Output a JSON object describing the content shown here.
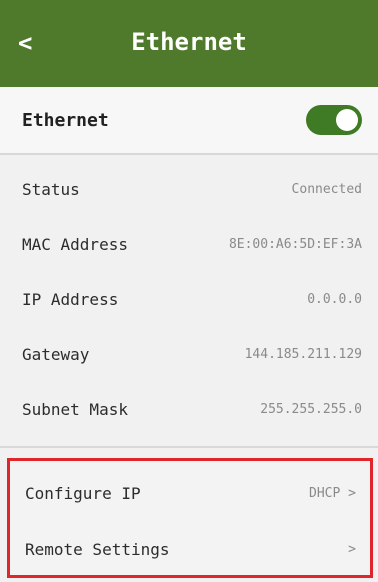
{
  "header": {
    "back_label": "<",
    "title": "Ethernet",
    "color": "#4f7a2c"
  },
  "ethernet_toggle": {
    "label": "Ethernet",
    "on": true,
    "color": "#3f7a24"
  },
  "info": [
    {
      "label": "Status",
      "value": "Connected"
    },
    {
      "label": "MAC Address",
      "value": "8E:00:A6:5D:EF:3A"
    },
    {
      "label": "IP Address",
      "value": "0.0.0.0"
    },
    {
      "label": "Gateway",
      "value": "144.185.211.129"
    },
    {
      "label": "Subnet Mask",
      "value": "255.255.255.0"
    }
  ],
  "settings": [
    {
      "label": "Configure IP",
      "value": "DHCP >"
    },
    {
      "label": "Remote Settings",
      "value": ">"
    }
  ],
  "highlight_color": "#e0262b"
}
